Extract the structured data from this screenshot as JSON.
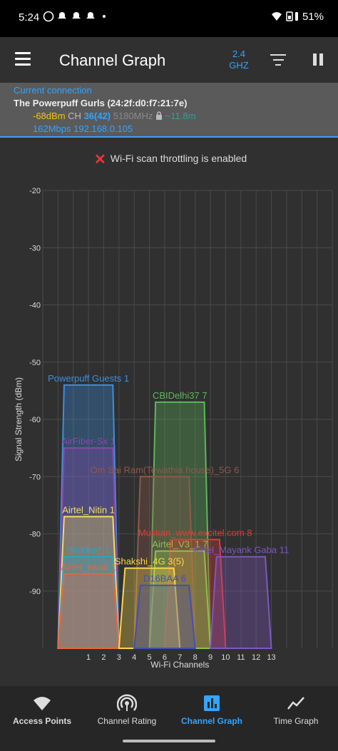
{
  "status_bar": {
    "time": "5:24",
    "battery": "51%"
  },
  "app_bar": {
    "title": "Channel Graph",
    "band_line1": "2.4",
    "band_line2": "GHZ"
  },
  "connection": {
    "label": "Current connection",
    "ssid": "The Powerpuff Gurls (24:2f:d0:f7:21:7e)",
    "signal": "-68dBm",
    "ch_label": "CH",
    "channel": "36(42)",
    "frequency": "5180MHz",
    "distance": "~11.8m",
    "speed": "162Mbps",
    "ip": "192.168.0.105"
  },
  "throttle_message": "Wi-Fi scan throttling is enabled",
  "chart_data": {
    "type": "area",
    "xlabel": "Wi-Fi Channels",
    "ylabel": "Signal Strength (dBm)",
    "xlim": [
      -2,
      17
    ],
    "ylim": [
      -100,
      -20
    ],
    "x_ticks": [
      1,
      2,
      3,
      4,
      5,
      6,
      7,
      8,
      9,
      10,
      11,
      12,
      13
    ],
    "y_ticks": [
      -20,
      -30,
      -40,
      -50,
      -60,
      -70,
      -80,
      -90
    ],
    "series": [
      {
        "name": "Powerpuff Guests 1",
        "channel": 1,
        "signal": -54,
        "color": "#3a8fe0"
      },
      {
        "name": "CBIDelhi37 7",
        "channel": 7,
        "signal": -57,
        "color": "#5cb85c"
      },
      {
        "name": "AirFiber-Sx 1",
        "channel": 1,
        "signal": -65,
        "color": "#8e44ad"
      },
      {
        "name": "Om Sai Ram(Tewathia house)_5G 6",
        "channel": 6,
        "signal": -70,
        "color": "#8d5a4a"
      },
      {
        "name": "Airtel_Nitin 1",
        "channel": 1,
        "signal": -77,
        "color": "#f1e05a"
      },
      {
        "name": "Muskan_www.excitel.com 8",
        "channel": 8,
        "signal": -81,
        "color": "#e53935"
      },
      {
        "name": "*hidden* 1",
        "channel": 1,
        "signal": -84,
        "color": "#26a6c9"
      },
      {
        "name": "Airtel_V3_1 7",
        "channel": 7,
        "signal": -83,
        "color": "#8bc34a"
      },
      {
        "name": "Airtel_Mayank Gaba 11",
        "channel": 11,
        "signal": -84,
        "color": "#7e57c2"
      },
      {
        "name": "Airtel_swati 1",
        "channel": 1,
        "signal": -87,
        "color": "#e8663d"
      },
      {
        "name": "Shakshi_4G 3(5)",
        "channel": 5,
        "signal": -86,
        "color": "#f9d74a"
      },
      {
        "name": "D16BAA 6",
        "channel": 6,
        "signal": -89,
        "color": "#3f51b5"
      }
    ]
  },
  "bottom_nav": {
    "items": [
      {
        "label": "Access Points",
        "icon": "wifi-icon"
      },
      {
        "label": "Channel Rating",
        "icon": "signal-rating-icon"
      },
      {
        "label": "Channel Graph",
        "icon": "bar-chart-icon"
      },
      {
        "label": "Time Graph",
        "icon": "line-chart-icon"
      }
    ],
    "active_index": 2
  },
  "colors": {
    "accent": "#33a4ff",
    "background": "#303030",
    "connection_bg": "#5a5a5a"
  }
}
